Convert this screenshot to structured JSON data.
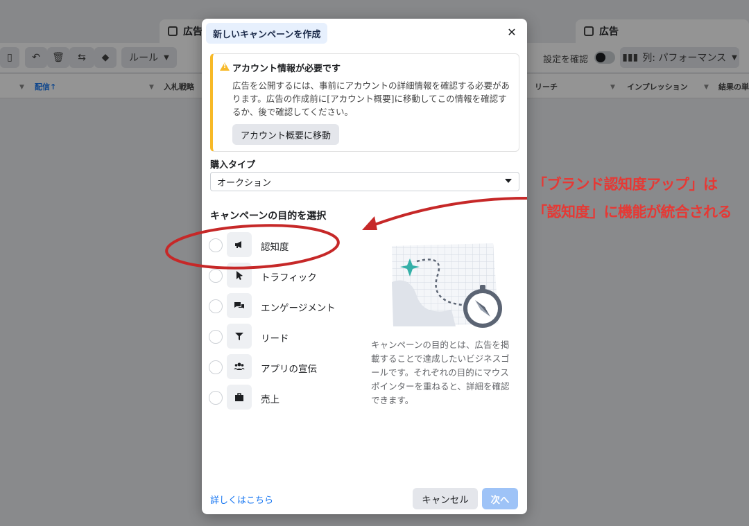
{
  "background": {
    "tabs": [
      {
        "label": "広告"
      },
      {
        "label": "広告"
      }
    ],
    "toolbar": {
      "rules_label": "ルール",
      "settings_check_label": "設定を確認",
      "columns_label": "列: パフォーマンス"
    },
    "columns": [
      "配信↑",
      "入札戦略",
      "リーチ",
      "インプレッション",
      "結果の単"
    ]
  },
  "modal": {
    "title": "新しいキャンペーンを作成",
    "close_icon": "close-icon",
    "alert": {
      "title": "アカウント情報が必要です",
      "body": "広告を公開するには、事前にアカウントの詳細情報を確認する必要があります。広告の作成前に[アカウント概要]に移動してこの情報を確認するか、後で確認してください。",
      "button_label": "アカウント概要に移動"
    },
    "purchase_type": {
      "label": "購入タイプ",
      "value": "オークション"
    },
    "objective_heading": "キャンペーンの目的を選択",
    "objectives": [
      {
        "label": "認知度",
        "icon": "megaphone-icon"
      },
      {
        "label": "トラフィック",
        "icon": "cursor-icon"
      },
      {
        "label": "エンゲージメント",
        "icon": "chat-bubbles-icon"
      },
      {
        "label": "リード",
        "icon": "funnel-icon"
      },
      {
        "label": "アプリの宣伝",
        "icon": "people-icon"
      },
      {
        "label": "売上",
        "icon": "briefcase-icon"
      }
    ],
    "description": "キャンペーンの目的とは、広告を掲載することで達成したいビジネスゴールです。それぞれの目的にマウスポインターを重ねると、詳細を確認できます。",
    "learn_more": "詳しくはこちら",
    "cancel_label": "キャンセル",
    "next_label": "次へ"
  },
  "annotation": {
    "line1": "「ブランド認知度アップ」は",
    "line2": "「認知度」に機能が統合される",
    "color": "#e53935"
  }
}
